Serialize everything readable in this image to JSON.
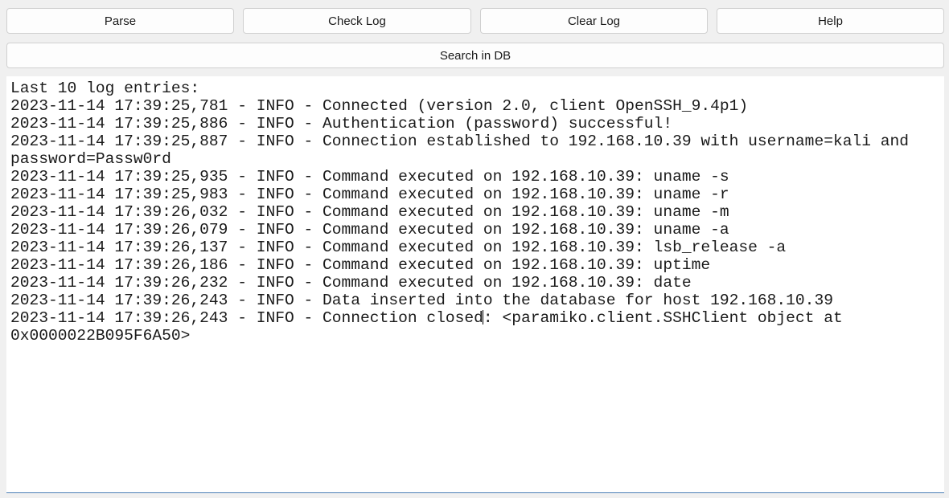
{
  "toolbar": {
    "parse_label": "Parse",
    "check_log_label": "Check Log",
    "clear_log_label": "Clear Log",
    "help_label": "Help",
    "search_db_label": "Search in DB"
  },
  "log": {
    "lines": [
      "Last 10 log entries:",
      "2023-11-14 17:39:25,781 - INFO - Connected (version 2.0, client OpenSSH_9.4p1)",
      "2023-11-14 17:39:25,886 - INFO - Authentication (password) successful!",
      "2023-11-14 17:39:25,887 - INFO - Connection established to 192.168.10.39 with username=kali and password=Passw0rd",
      "2023-11-14 17:39:25,935 - INFO - Command executed on 192.168.10.39: uname -s",
      "2023-11-14 17:39:25,983 - INFO - Command executed on 192.168.10.39: uname -r",
      "2023-11-14 17:39:26,032 - INFO - Command executed on 192.168.10.39: uname -m",
      "2023-11-14 17:39:26,079 - INFO - Command executed on 192.168.10.39: uname -a",
      "2023-11-14 17:39:26,137 - INFO - Command executed on 192.168.10.39: lsb_release -a",
      "2023-11-14 17:39:26,186 - INFO - Command executed on 192.168.10.39: uptime",
      "2023-11-14 17:39:26,232 - INFO - Command executed on 192.168.10.39: date",
      "2023-11-14 17:39:26,243 - INFO - Data inserted into the database for host 192.168.10.39"
    ],
    "last_line_before_caret": "2023-11-14 17:39:26,243 - INFO - Connection closed",
    "last_line_after_caret": ": <paramiko.client.SSHClient object at 0x0000022B095F6A50>"
  }
}
